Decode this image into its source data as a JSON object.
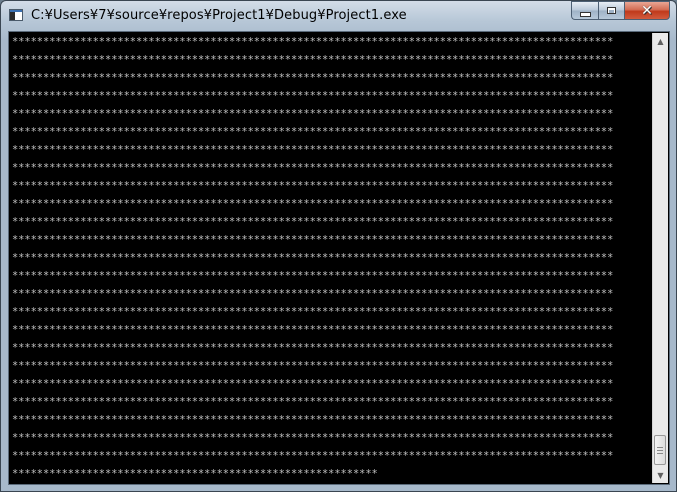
{
  "window": {
    "title": "C:¥Users¥7¥source¥repos¥Project1¥Debug¥Project1.exe",
    "icon": "console-app-icon",
    "controls": {
      "minimize_icon": "minimize-icon",
      "maximize_icon": "maximize-icon",
      "close_icon": "close-icon",
      "close_glyph": "✕"
    }
  },
  "console": {
    "background": "#000000",
    "foreground": "#c0c0c0",
    "lines": [
      "*************************************************************************************************",
      "*************************************************************************************************",
      "*************************************************************************************************",
      "*************************************************************************************************",
      "*************************************************************************************************",
      "*************************************************************************************************",
      "*************************************************************************************************",
      "*************************************************************************************************",
      "*************************************************************************************************",
      "*************************************************************************************************",
      "*************************************************************************************************",
      "*************************************************************************************************",
      "*************************************************************************************************",
      "*************************************************************************************************",
      "*************************************************************************************************",
      "*************************************************************************************************",
      "*************************************************************************************************",
      "*************************************************************************************************",
      "*************************************************************************************************",
      "*************************************************************************************************",
      "*************************************************************************************************",
      "*************************************************************************************************",
      "*************************************************************************************************",
      "*************************************************************************************************",
      "***********************************************************"
    ]
  },
  "scrollbar": {
    "up_arrow": "▲",
    "down_arrow": "▼"
  }
}
